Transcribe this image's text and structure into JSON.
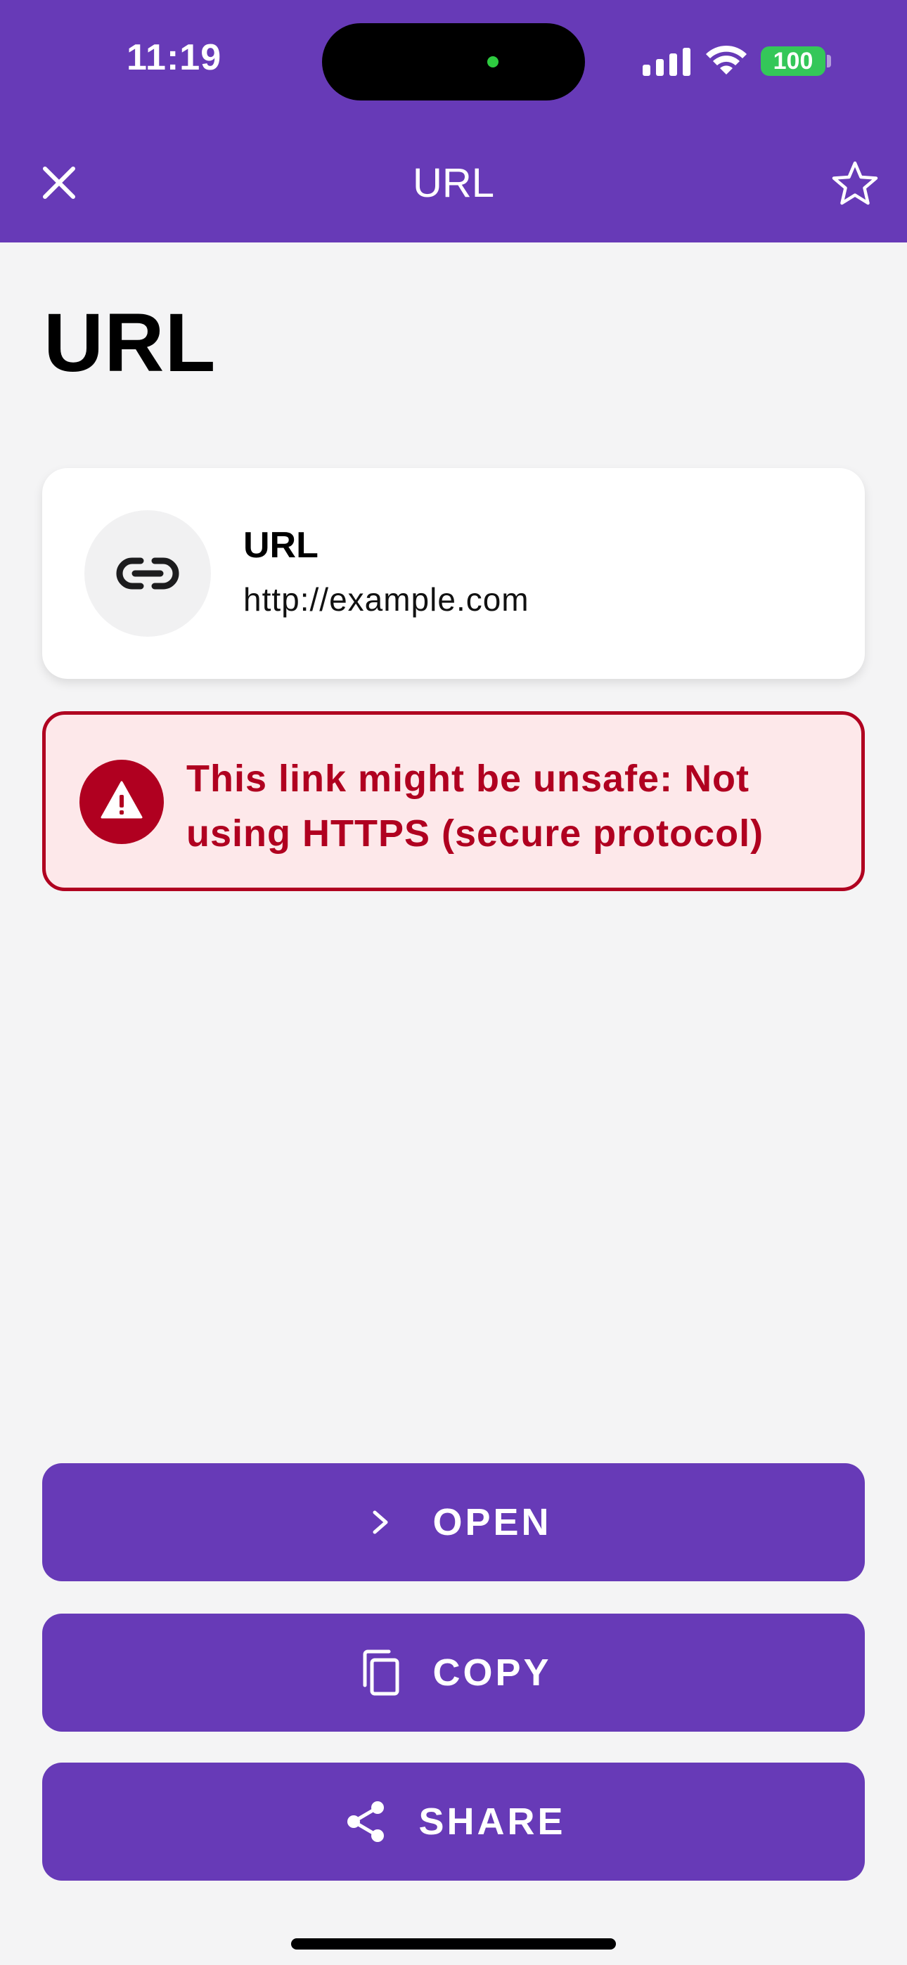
{
  "status_bar": {
    "time": "11:19",
    "battery": "100"
  },
  "nav": {
    "title": "URL",
    "close_icon": "close-icon",
    "favorite_icon": "star-outline-icon"
  },
  "page": {
    "title": "URL"
  },
  "result_card": {
    "icon": "link-icon",
    "label": "URL",
    "value": "http://example.com"
  },
  "warning": {
    "icon": "warning-icon",
    "message": "This link might be unsafe: Not using HTTPS (secure protocol)"
  },
  "actions": {
    "open": {
      "label": "OPEN",
      "icon": "chevron-right-icon"
    },
    "copy": {
      "label": "COPY",
      "icon": "copy-icon"
    },
    "share": {
      "label": "SHARE",
      "icon": "share-icon"
    }
  },
  "colors": {
    "primary": "#673ab7",
    "background": "#f4f4f5",
    "warning": "#b00020",
    "warning_bg": "#fde8ea"
  }
}
